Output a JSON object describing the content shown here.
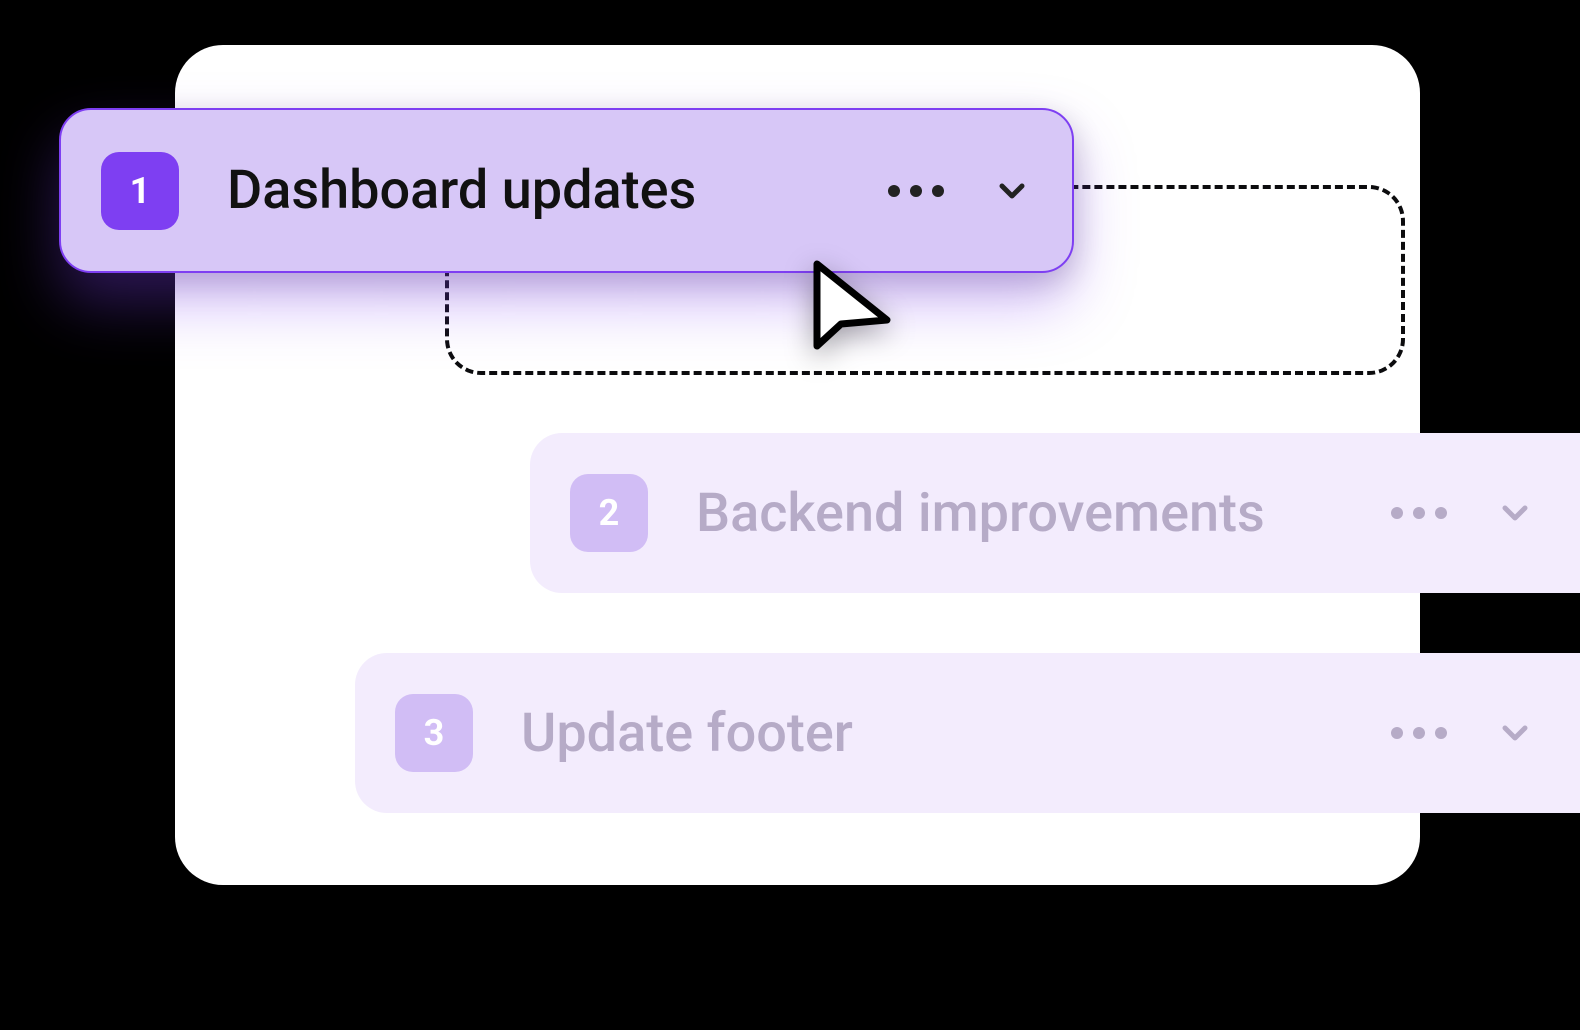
{
  "rows": [
    {
      "num": "1",
      "title": "Dashboard updates"
    },
    {
      "num": "2",
      "title": "Backend improvements"
    },
    {
      "num": "3",
      "title": "Update footer"
    }
  ],
  "colors": {
    "accent": "#7e3ff2",
    "row_bg": "#f3ecfd",
    "drag_bg": "#d7c7f7"
  }
}
